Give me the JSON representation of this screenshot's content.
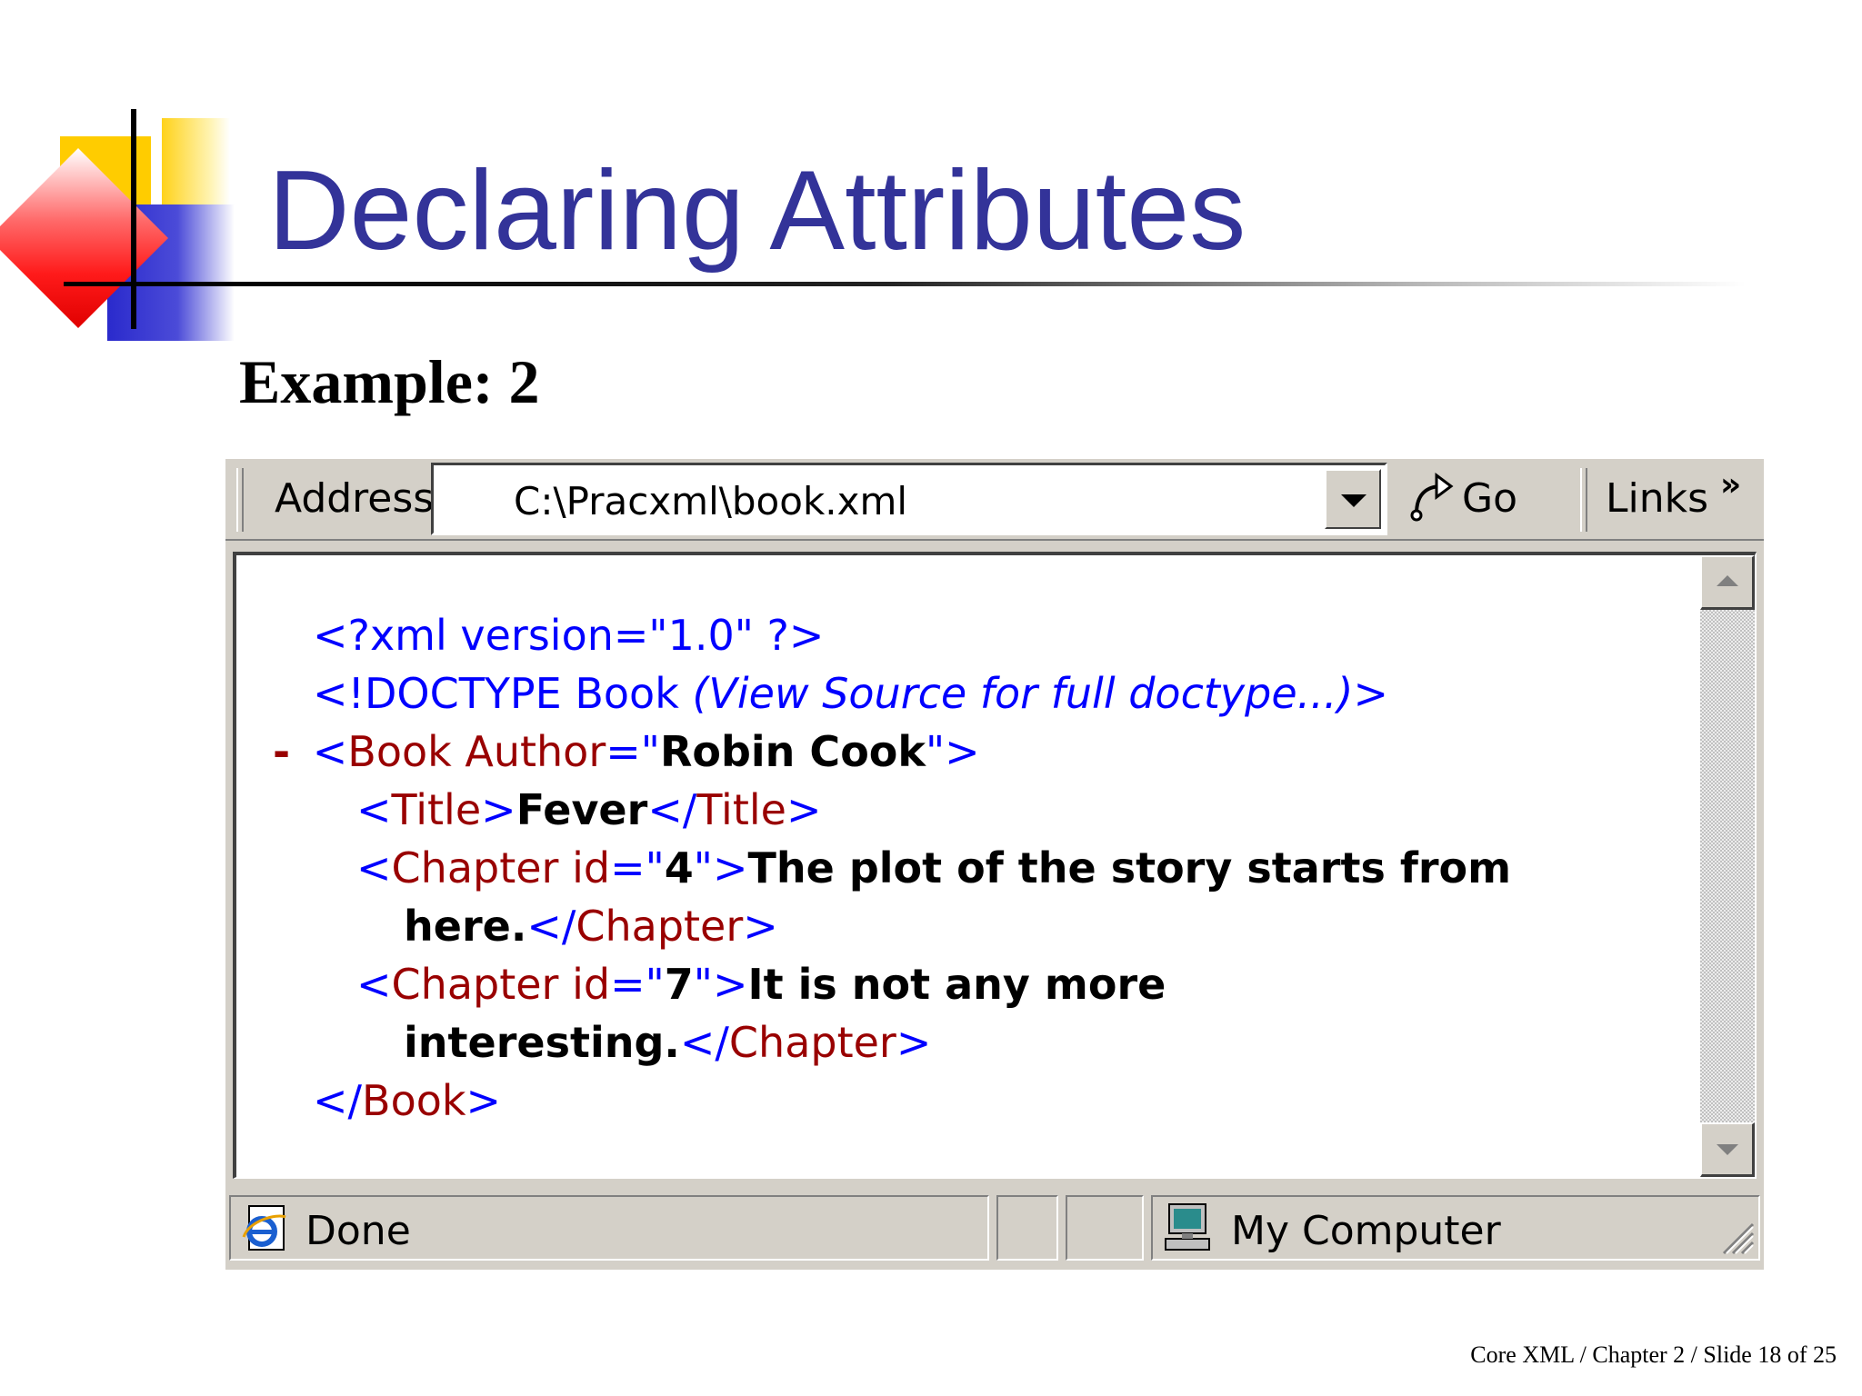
{
  "slide": {
    "title": "Declaring Attributes",
    "subtitle": "Example: 2",
    "footer": "Core XML / Chapter 2 / Slide 18 of 25"
  },
  "browser": {
    "address_label": "Address",
    "address_value": "C:\\Pracxml\\book.xml",
    "go_label": "Go",
    "links_label": "Links",
    "links_more": "»",
    "status": {
      "text": "Done",
      "zone": "My Computer"
    },
    "xml": {
      "l1": "<?xml version=\"1.0\" ?>",
      "l2_tag": "<!DOCTYPE Book ",
      "l2_note": "(View Source for full doctype...)",
      "l2_end": ">",
      "collapse": "-",
      "l3_open": "<",
      "l3_name": "Book Author",
      "l3_eq": "=\"",
      "l3_value": "Robin Cook",
      "l3_close": "\">",
      "l4_open": "<",
      "l4_name": "Title",
      "l4_gt": ">",
      "l4_text": "Fever",
      "l4_endo": "</",
      "l4_endname": "Title",
      "l4_endc": ">",
      "l5_open": "<",
      "l5_name": "Chapter id",
      "l5_eq": "=\"",
      "l5_value": "4",
      "l5_close": "\">",
      "l5_text": "The plot of the story starts from",
      "l6_text": "here.",
      "l6_endo": "</",
      "l6_endname": "Chapter",
      "l6_endc": ">",
      "l7_open": "<",
      "l7_name": "Chapter id",
      "l7_eq": "=\"",
      "l7_value": "7",
      "l7_close": "\">",
      "l7_text": "It is not any more",
      "l8_text": "interesting.",
      "l8_endo": "</",
      "l8_endname": "Chapter",
      "l8_endc": ">",
      "l9_endo": "</",
      "l9_endname": "Book",
      "l9_endc": ">"
    }
  },
  "icons": {
    "ie": "internet-explorer-icon",
    "computer": "my-computer-icon",
    "go": "go-arrow-icon"
  },
  "colors": {
    "title": "#333399",
    "markup": "#0000ff",
    "element_name": "#990000",
    "chrome": "#d4d0c8"
  }
}
